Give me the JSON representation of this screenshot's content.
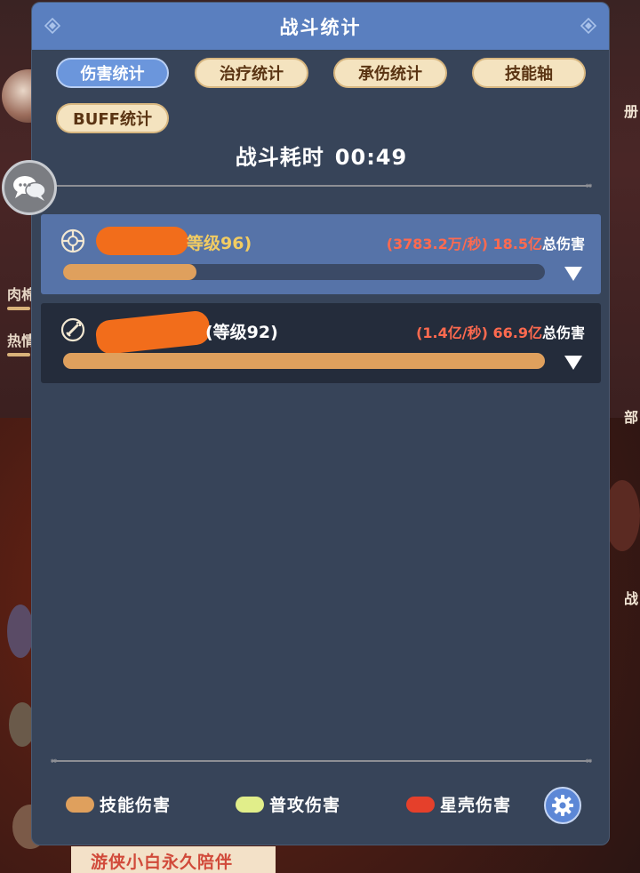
{
  "panel": {
    "title": "战斗统计"
  },
  "tabs": [
    {
      "label": "伤害统计",
      "active": true
    },
    {
      "label": "治疗统计",
      "active": false
    },
    {
      "label": "承伤统计",
      "active": false
    },
    {
      "label": "技能轴",
      "active": false
    },
    {
      "label": "BUFF统计",
      "active": false
    }
  ],
  "timer": {
    "label": "战斗耗时",
    "value": "00:49"
  },
  "rows": [
    {
      "level_text": "等级96)",
      "dps_text": "(3783.2万/秒)",
      "total_value": "18.5亿",
      "total_label": "总伤害",
      "bar_fraction": 0.276,
      "selected": true,
      "icon": "crosshair-class-icon"
    },
    {
      "level_text": "(等级92)",
      "dps_text": "(1.4亿/秒)",
      "total_value": "66.9亿",
      "total_label": "总伤害",
      "bar_fraction": 1.0,
      "selected": false,
      "icon": "sword-class-icon"
    }
  ],
  "legend": [
    {
      "label": "技能伤害",
      "color": "#dfa05d"
    },
    {
      "label": "普攻伤害",
      "color": "#e1ee8a"
    },
    {
      "label": "星壳伤害",
      "color": "#e5402b"
    }
  ],
  "colors": {
    "header": "#5a7fbf",
    "panel": "#374459",
    "accent_red": "#ff6a4f",
    "level_gold": "#f2cc62"
  },
  "background": {
    "side_texts": [
      "肉棉",
      "热情"
    ],
    "right_texts": [
      "册",
      "部",
      "战"
    ],
    "banner": "游侠小白永久陪伴"
  }
}
